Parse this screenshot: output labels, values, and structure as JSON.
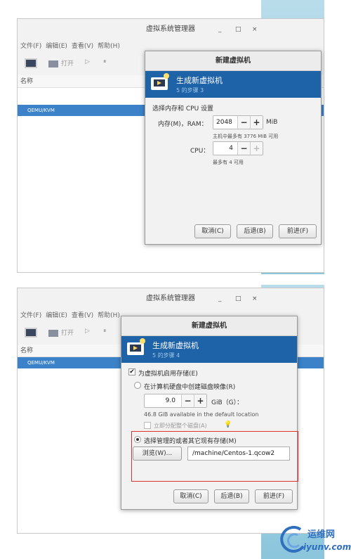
{
  "app": {
    "title": "虚拟系统管理器",
    "window_controls": {
      "minimize": "_",
      "maximize": "□",
      "close": "×"
    },
    "menu": [
      "文件(F)",
      "编辑(E)",
      "查看(V)",
      "帮助(H)"
    ],
    "toolbar": {
      "open": "打开",
      "run": "▷",
      "pause": "⏸"
    },
    "list_header": "名称",
    "connection": "QEMU/KVM"
  },
  "step3": {
    "dialog_title": "新建虚拟机",
    "banner_title": "生成新虚拟机",
    "banner_step": "5 的步骤 3",
    "section_label": "选择内存和 CPU 设置",
    "memory_label": "内存(M)，RAM：",
    "memory_value": "2048",
    "memory_unit": "MiB",
    "memory_hint": "主机中最多有 3776 MiB 可用",
    "cpu_label": "CPU：",
    "cpu_value": "4",
    "cpu_hint": "最多有 4 可用",
    "minus": "−",
    "plus": "+",
    "cancel": "取消(C)",
    "back": "后退(B)",
    "forward": "前进(F)"
  },
  "step4": {
    "dialog_title": "新建虚拟机",
    "banner_title": "生成新虚拟机",
    "banner_step": "5 的步骤 4",
    "enable_storage": "为虚拟机启用存储(E)",
    "create_image": "在计算机硬盘中创建磁盘映像(R)",
    "disk_value": "9.0",
    "disk_unit": "GiB（G）：",
    "available": "46.8 GiB available in the default location",
    "allocate": "立即分配整个磁盘(A)",
    "select_existing": "选择管理的或者其它现有存储(M)",
    "browse": "浏览(W)...",
    "path": "/machine/Centos-1.qcow2",
    "minus": "−",
    "plus": "+",
    "cancel": "取消(C)",
    "back": "后退(B)",
    "forward": "前进(F)"
  },
  "watermark": {
    "text": "运维网",
    "url": "iyunv.com"
  },
  "colors": {
    "accent": "#1e62a8",
    "selection": "#3b82c8",
    "highlight_box": "#e03030"
  }
}
